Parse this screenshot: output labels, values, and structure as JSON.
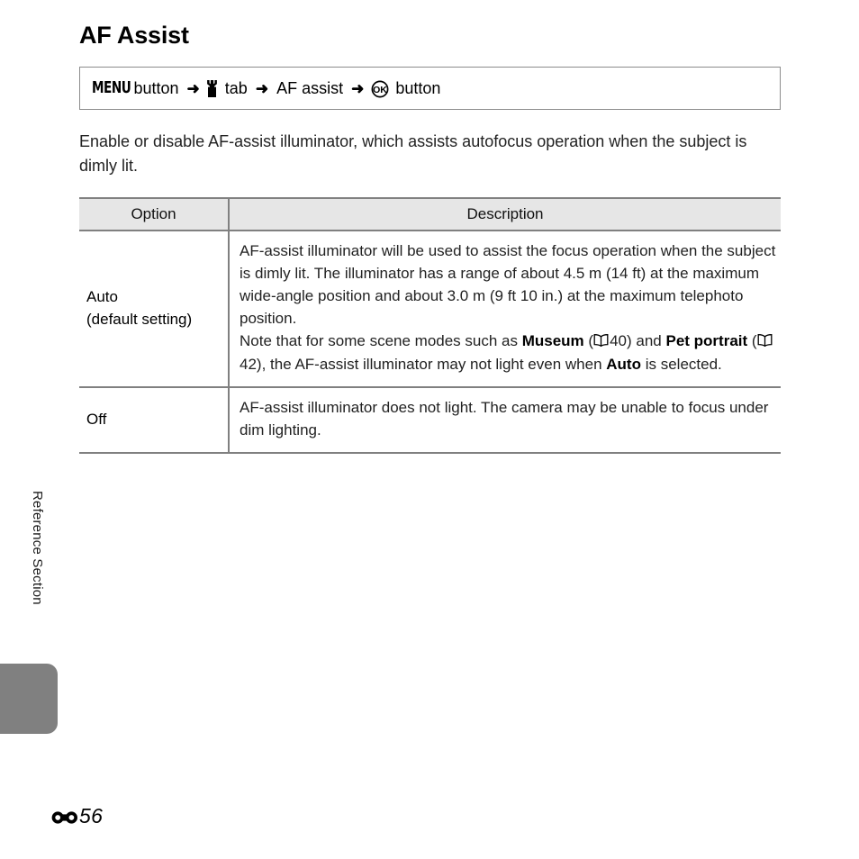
{
  "page": {
    "title": "AF Assist",
    "side_label": "Reference Section",
    "page_number": "56",
    "reference_symbol": "reference-section-symbol"
  },
  "menu_path": {
    "menu_label": "MENU",
    "button_word_1": "button",
    "arrow": "➜",
    "setup_tab_icon": "wrench-icon",
    "tab_word": "tab",
    "item_label": "AF assist",
    "ok_icon": "ok-button-icon",
    "button_word_2": "button",
    "full_text": "MENU button ➜ Y tab ➜ AF assist ➜ OK button"
  },
  "intro": {
    "text": "Enable or disable AF-assist illuminator, which assists autofocus operation when the subject is dimly lit."
  },
  "table": {
    "headers": {
      "option": "Option",
      "description": "Description"
    },
    "rows": [
      {
        "option_main": "Auto",
        "option_sub": "(default setting)",
        "description_p1": "AF-assist illuminator will be used to assist the focus operation when the subject is dimly lit. The illuminator has a range of about 4.5 m (14 ft) at the maximum wide-angle position and about 3.0 m (9 ft 10 in.) at the maximum telephoto position.",
        "note": {
          "lead": "Note that for some scene modes such as ",
          "bold_1": "Museum",
          "ref_open_1": " (",
          "page_ref_1": "40",
          "ref_close_1": ") and ",
          "bold_2": "Pet portrait",
          "ref_open_2": " (",
          "page_ref_2": "42",
          "ref_close_2": "), the AF-assist illuminator may not light even when ",
          "bold_3": "Auto",
          "tail": " is selected."
        }
      },
      {
        "option_main": "Off",
        "option_sub": "",
        "description_p1": "AF-assist illuminator does not light. The camera may be unable to focus under dim lighting.",
        "note": null
      }
    ]
  },
  "colors": {
    "tab_gray": "#808080",
    "header_fill": "#e6e6e6",
    "rule_gray": "#808080",
    "box_border": "#8c8c8c",
    "text": "#222222"
  }
}
